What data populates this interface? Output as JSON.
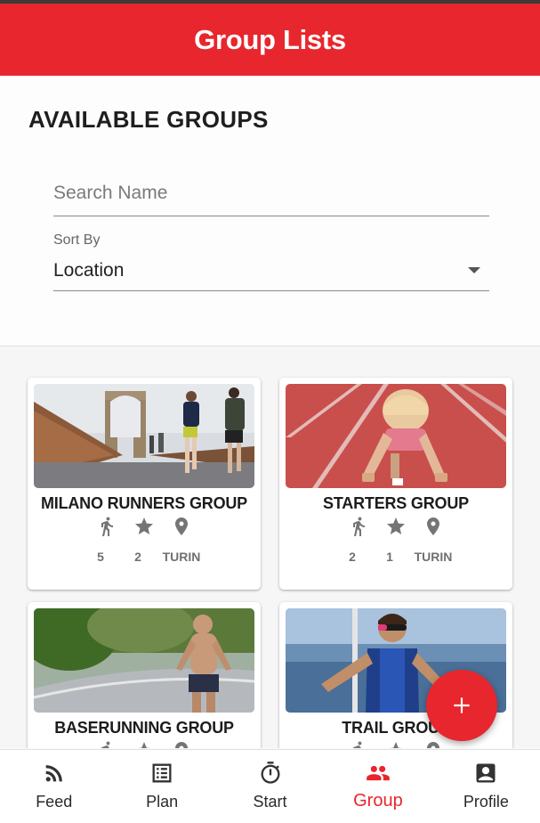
{
  "app_bar": {
    "title": "Group Lists"
  },
  "filters": {
    "section_title": "AVAILABLE GROUPS",
    "search_placeholder": "Search Name",
    "sort_label": "Sort By",
    "sort_value": "Location"
  },
  "groups": [
    {
      "name": "MILANO RUNNERS GROUP",
      "members": "5",
      "rating": "2",
      "location": "TURIN"
    },
    {
      "name": "STARTERS GROUP",
      "members": "2",
      "rating": "1",
      "location": "TURIN"
    },
    {
      "name": "BASERUNNING GROUP",
      "members": "",
      "rating": "",
      "location": ""
    },
    {
      "name": "TRAIL GROUP",
      "members": "",
      "rating": "",
      "location": ""
    }
  ],
  "icons": {
    "members": "runner-icon",
    "rating": "star-icon",
    "location": "location-pin-icon",
    "fab": "plus-icon"
  },
  "colors": {
    "accent": "#e8262d",
    "icon_gray": "#757575",
    "text_dark": "#1e1e1e"
  },
  "bottom_nav": [
    {
      "label": "Feed",
      "icon": "rss-feed-icon"
    },
    {
      "label": "Plan",
      "icon": "list-icon"
    },
    {
      "label": "Start",
      "icon": "stopwatch-icon"
    },
    {
      "label": "Group",
      "icon": "group-icon",
      "active": true
    },
    {
      "label": "Profile",
      "icon": "profile-icon"
    }
  ]
}
